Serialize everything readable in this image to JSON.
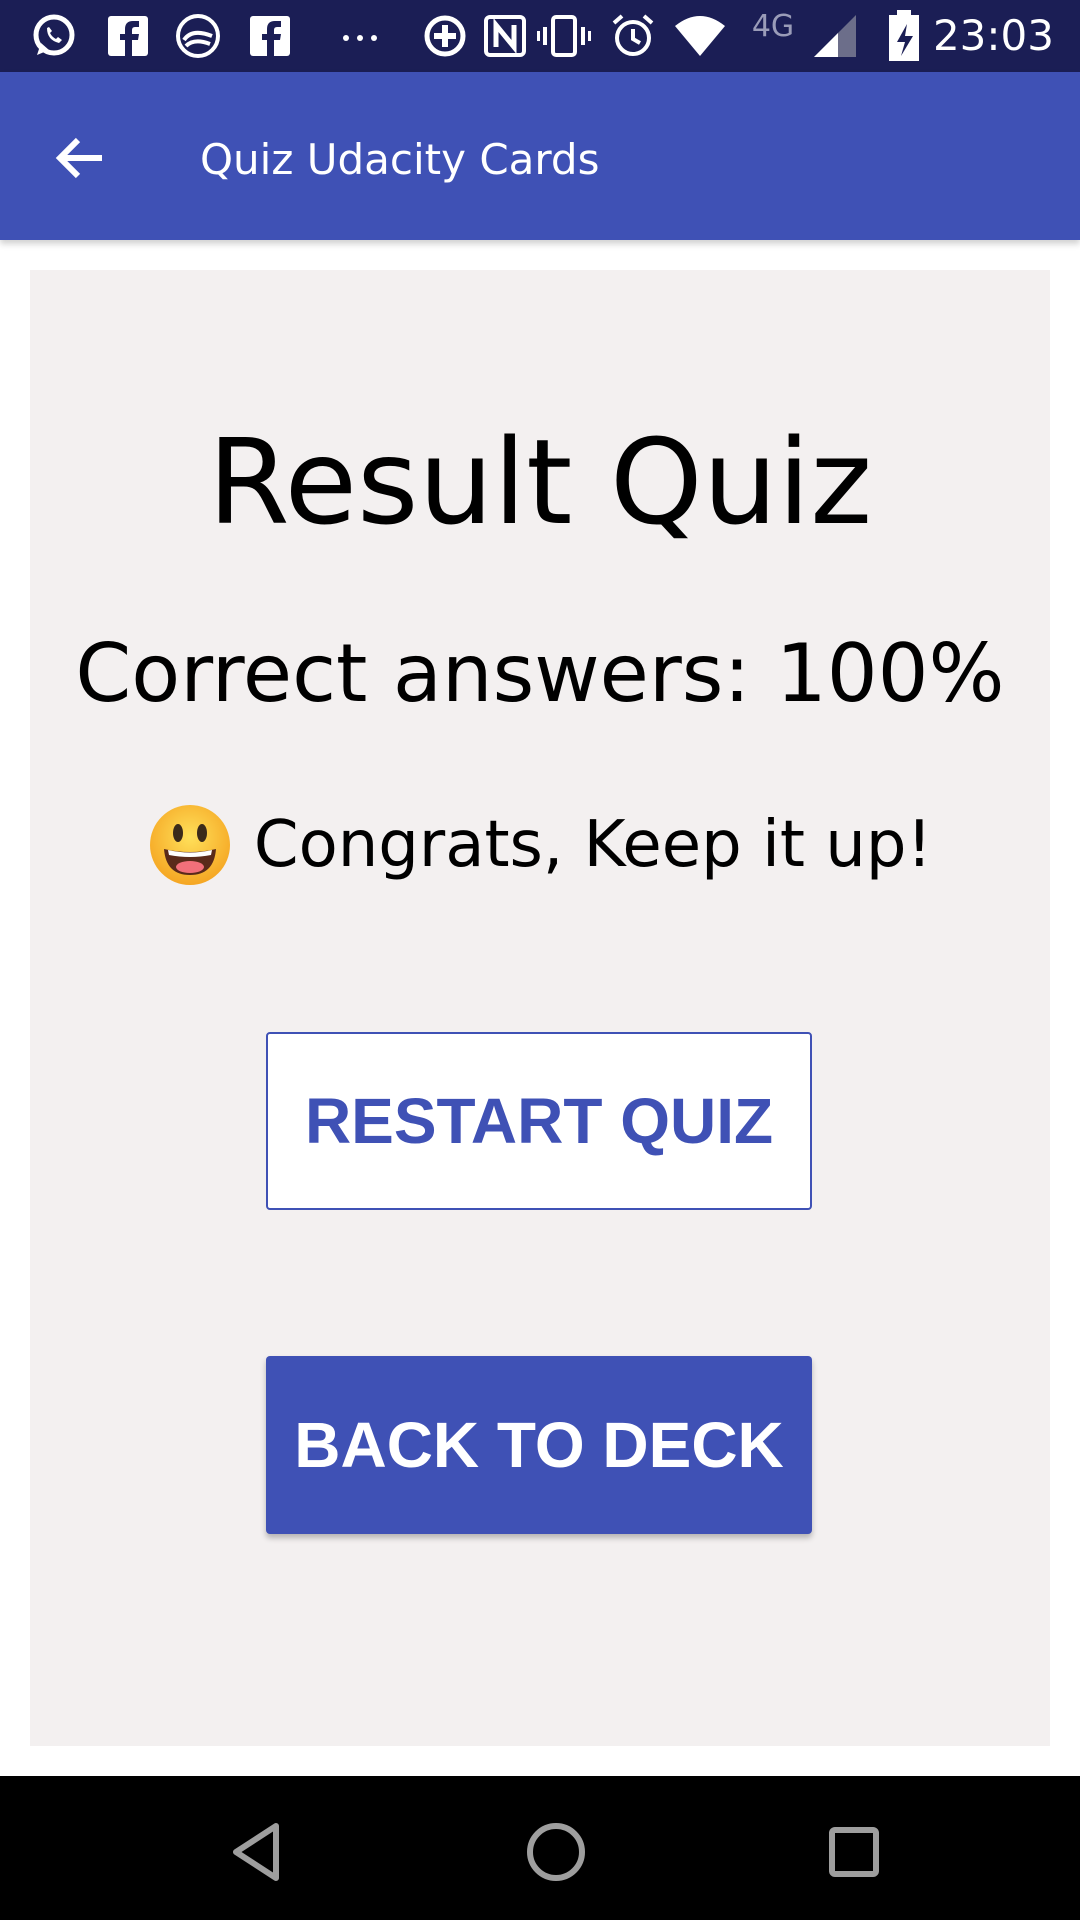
{
  "status_bar": {
    "time": "23:03",
    "network_label": "4G",
    "icons": [
      "whatsapp-icon",
      "facebook-icon",
      "feed-icon",
      "facebook-icon",
      "more-notifications-icon",
      "data-saver-icon",
      "nfc-icon",
      "vibrate-icon",
      "alarm-icon",
      "wifi-icon",
      "signal-icon",
      "battery-charging-icon"
    ]
  },
  "app_bar": {
    "title": "Quiz Udacity Cards",
    "back_icon": "arrow-back-icon"
  },
  "result": {
    "title": "Result Quiz",
    "correct_answers": "Correct answers: 100%",
    "emoji": "grinning-face-icon",
    "message": "Congrats, Keep it up!"
  },
  "buttons": {
    "restart_label": "RESTART QUIZ",
    "back_to_deck_label": "BACK TO DECK"
  },
  "nav_bar": {
    "icons": [
      "nav-back-icon",
      "nav-home-icon",
      "nav-recents-icon"
    ]
  },
  "colors": {
    "primary": "#3f51b5",
    "status_bar": "#1b1e55",
    "card_background": "#f3f0f0"
  }
}
